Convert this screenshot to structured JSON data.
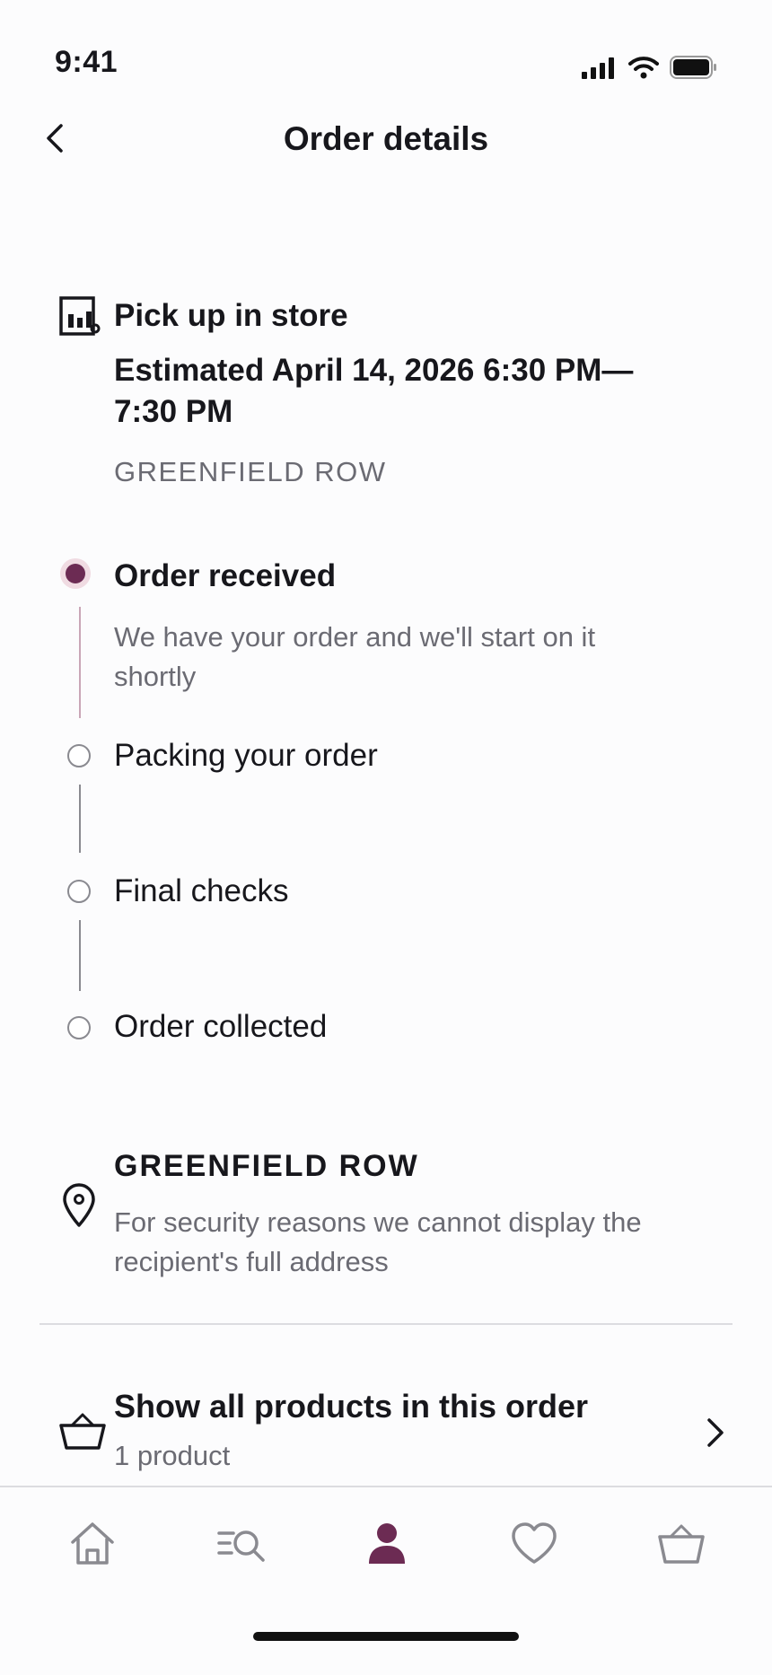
{
  "status_bar": {
    "time": "9:41"
  },
  "header": {
    "title": "Order details"
  },
  "pickup": {
    "method": "Pick up in store",
    "estimate": "Estimated April 14, 2026 6:30 PM— 7:30 PM",
    "store_caps": "GREENFIELD ROW"
  },
  "timeline": {
    "steps": [
      {
        "label": "Order received",
        "description": "We have your order and we'll start on it shortly",
        "state": "active"
      },
      {
        "label": "Packing your order",
        "state": "pending"
      },
      {
        "label": "Final checks",
        "state": "pending"
      },
      {
        "label": "Order collected",
        "state": "pending"
      }
    ]
  },
  "address": {
    "store_name": "GREENFIELD ROW",
    "note": "For security reasons we cannot display the recipient's full address"
  },
  "products": {
    "title": "Show all products in this order",
    "count": "1 product"
  },
  "tabbar": {
    "items": [
      {
        "icon": "home-icon",
        "active": false
      },
      {
        "icon": "search-list-icon",
        "active": false
      },
      {
        "icon": "account-icon",
        "active": true
      },
      {
        "icon": "heart-icon",
        "active": false
      },
      {
        "icon": "basket-icon",
        "active": false
      }
    ]
  },
  "colors": {
    "accent": "#6c2b53",
    "accent_light": "#f0dbe2",
    "muted_text": "#6b6b73",
    "divider": "#dcdce0"
  }
}
